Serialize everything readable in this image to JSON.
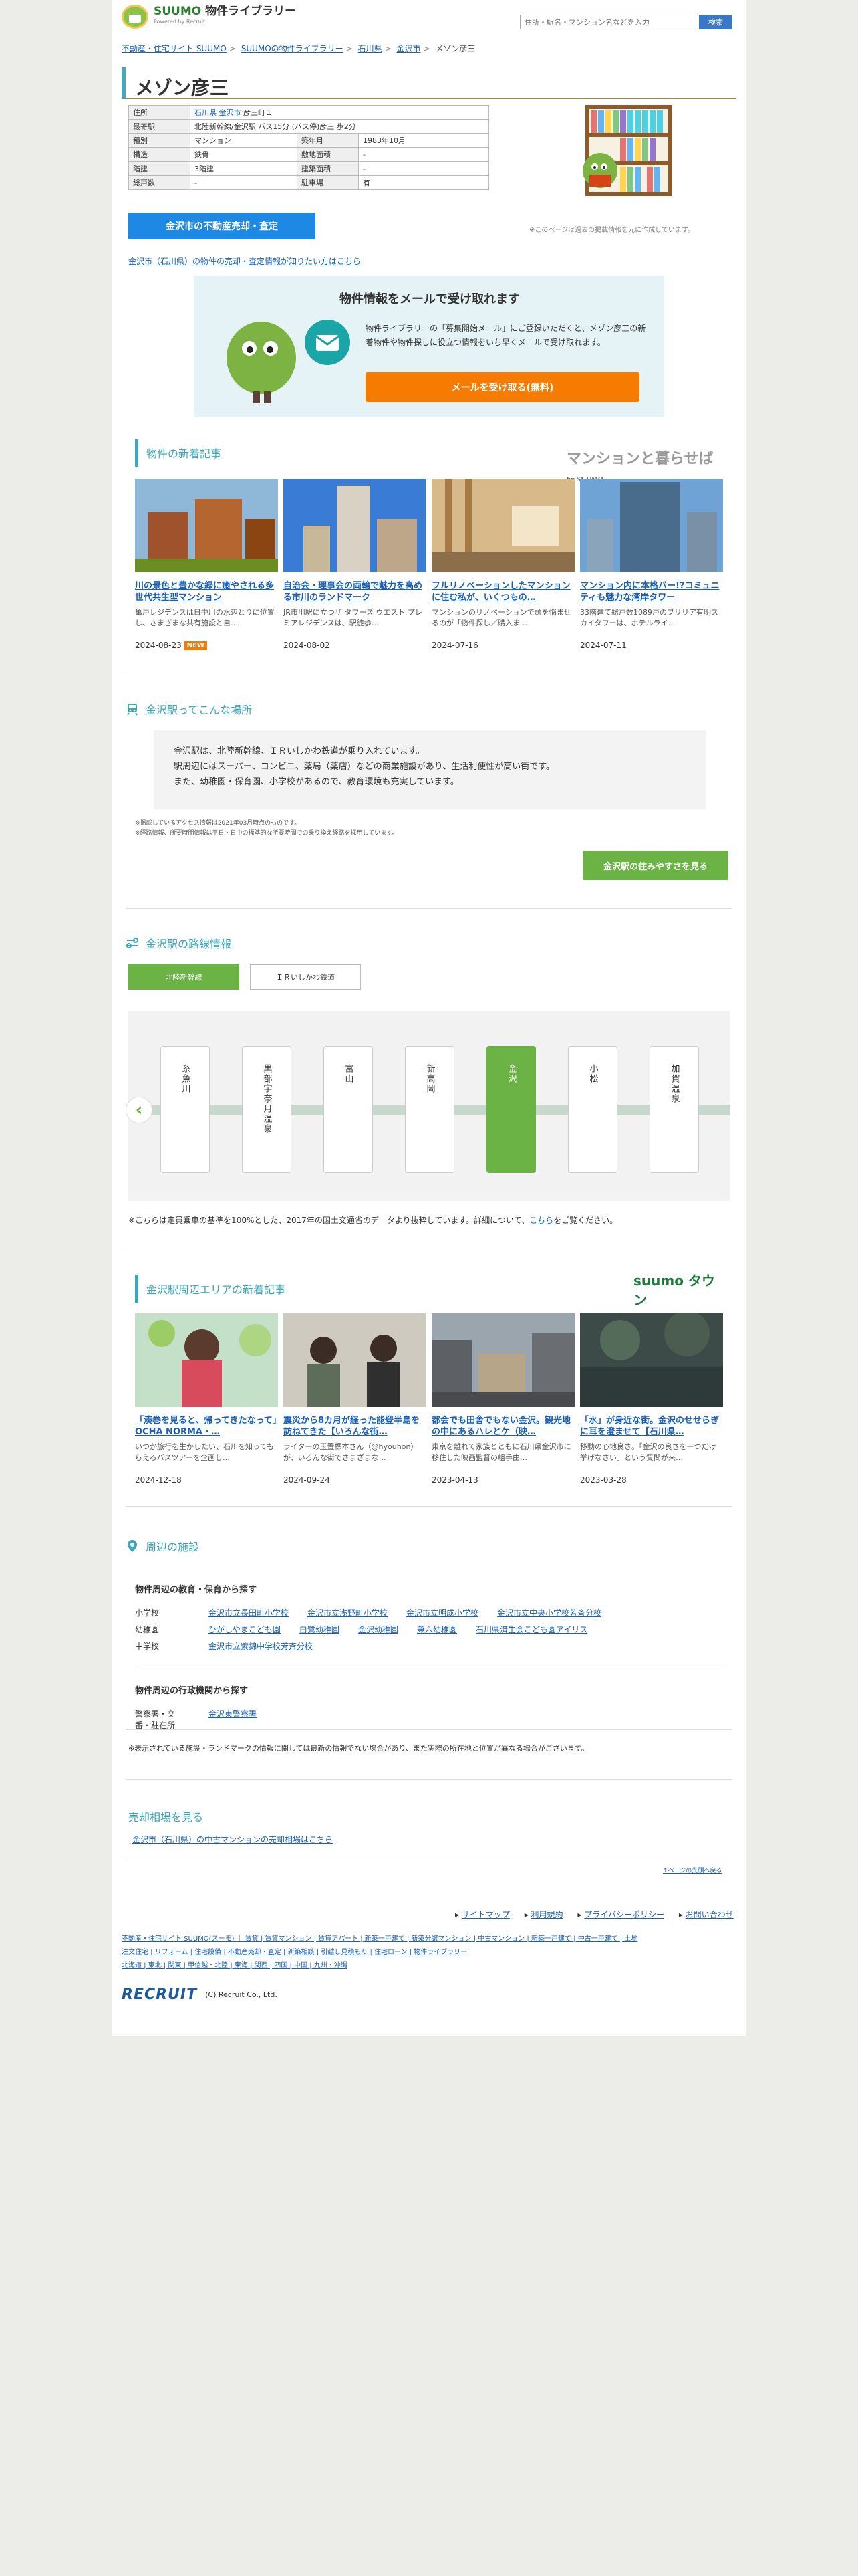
{
  "header": {
    "brand": "SUUMO",
    "brand_sub": "物件ライブラリー",
    "powered": "Powered by Recruit",
    "search_placeholder": "住所・駅名・マンション名などを入力",
    "search_button": "検索"
  },
  "breadcrumb": [
    "不動産・住宅サイト SUUMO",
    "SUUMOの物件ライブラリー",
    "石川県",
    "金沢市",
    "メゾン彦三"
  ],
  "title": "メゾン彦三",
  "info": {
    "rows": [
      {
        "k": "住所",
        "v": "石川県 金沢市 彦三町１",
        "full": true,
        "links": [
          "石川県",
          "金沢市"
        ]
      },
      {
        "k": "最寄駅",
        "v": "北陸新幹線/金沢駅 バス15分 (バス停)彦三 歩2分",
        "full": true
      },
      {
        "k": "種別",
        "v": "マンション",
        "k2": "築年月",
        "v2": "1983年10月"
      },
      {
        "k": "構造",
        "v": "鉄骨",
        "k2": "敷地面積",
        "v2": "-"
      },
      {
        "k": "階建",
        "v": "3階建",
        "k2": "建築面積",
        "v2": "-"
      },
      {
        "k": "総戸数",
        "v": "-",
        "k2": "駐車場",
        "v2": "有"
      }
    ],
    "image_note": "※このページは過去の掲載情報を元に作成しています。",
    "sale_button": "金沢市の不動産売却・査定",
    "sale_link": "金沢市（石川県）の物件の売却・査定情報が知りたい方はこちら"
  },
  "mail": {
    "heading": "物件情報をメールで受け取れます",
    "text": "物件ライブラリーの「募集開始メール」にご登録いただくと、メゾン彦三の新着物件や物件探しに役立つ情報をいち早くメールで受け取れます。",
    "button": "メールを受け取る(無料)"
  },
  "new_articles": {
    "title": "物件の新着記事",
    "brand": "マンションと暮らせば",
    "brand_sub": "by SUUMO",
    "items": [
      {
        "title": "川の景色と豊かな緑に癒やされる多世代共生型マンション",
        "desc": "亀戸レジデンスは日中川の水辺とりに位置し、さまざまな共有施設と自…",
        "date": "2024-08-23",
        "badge": "NEW"
      },
      {
        "title": "自治会・理事会の両輪で魅力を高める市川のランドマーク",
        "desc": "JR市川駅に立つザ タワーズ ウエスト プレミアレジデンスは、駅徒歩…",
        "date": "2024-08-02",
        "badge": ""
      },
      {
        "title": "フルリノベーションしたマンションに住む私が、いくつもの…",
        "desc": "マンションのリノベーションで頭を悩ませるのが「物件探し／購入ま…",
        "date": "2024-07-16",
        "badge": ""
      },
      {
        "title": "マンション内に本格バー!?コミュニティも魅力な湾岸タワー",
        "desc": "33階建て総戸数1089戸のブリリア有明スカイタワーは、ホテルライ…",
        "date": "2024-07-11",
        "badge": ""
      }
    ]
  },
  "station": {
    "title": "金沢駅ってこんな場所",
    "desc": [
      "金沢駅は、北陸新幹線、ＩＲいしかわ鉄道が乗り入れています。",
      "駅周辺にはスーパー、コンビニ、薬局（薬店）などの商業施設があり、生活利便性が高い街です。",
      "また、幼稚園・保育園、小学校があるので、教育環境も充実しています。"
    ],
    "notes": [
      "※掲載しているアクセス情報は2021年03月時点のものです。",
      "※経路情報、所要時間情報は平日・日中の標準的な所要時間での乗り換え経路を採用しています。"
    ],
    "button": "金沢駅の住みやすさを見る"
  },
  "route": {
    "title": "金沢駅の路線情報",
    "tabs": [
      "北陸新幹線",
      "ＩＲいしかわ鉄道"
    ],
    "stations": [
      "糸魚川",
      "黒部宇奈月温泉",
      "富山",
      "新高岡",
      "金沢",
      "小松",
      "加賀温泉"
    ],
    "current": "金沢",
    "note": "※こちらは定員乗車の基準を100%とした、2017年の国土交通省のデータより抜粋しています。詳細について、",
    "note_link": "こちら",
    "note_end": "をご覧ください。"
  },
  "area_articles": {
    "title": "金沢駅周辺エリアの新着記事",
    "brand": "suumo タウン",
    "items": [
      {
        "title": "「湊巻を見ると、帰ってきたなって」　OCHA NORMA・…",
        "desc": "いつか旅行を生かしたい、石川を知ってもらえるバスツアーを企画し…",
        "date": "2024-12-18"
      },
      {
        "title": "震災から8カ月が経った能登半島を訪ねてきた【いろんな街…",
        "desc": "ライターの玉置標本さん（@hyouhon）が、いろんな街でさまざまな…",
        "date": "2024-09-24"
      },
      {
        "title": "都会でも田舎でもない金沢。観光地の中にあるハレとケ（映…",
        "desc": "東京を離れて家族とともに石川県金沢市に移住した映画監督の岨手由…",
        "date": "2023-04-13"
      },
      {
        "title": "「水」が身近な街。金沢のせせらぎに耳を澄ませて【石川県…",
        "desc": "移動の心地良さ。「金沢の良さをーつだけ挙げなさい」という質問が来…",
        "date": "2023-03-28"
      }
    ]
  },
  "facilities": {
    "title": "周辺の施設",
    "sub1": "物件周辺の教育・保育から探す",
    "rows": [
      {
        "k": "小学校",
        "v": [
          "金沢市立長田町小学校",
          "金沢市立浅野町小学校",
          "金沢市立明成小学校",
          "金沢市立中央小学校芳斉分校"
        ]
      },
      {
        "k": "幼稚園",
        "v": [
          "ひがしやまこども園",
          "白鷺幼稚園",
          "金沢幼稚園",
          "兼六幼稚園",
          "石川県済生会こども園アイリス"
        ]
      },
      {
        "k": "中学校",
        "v": [
          "金沢市立紫錦中学校芳斉分校"
        ]
      }
    ],
    "sub2": "物件周辺の行政機関から探す",
    "rows2": [
      {
        "k": "警察署・交番・駐在所",
        "v": [
          "金沢東警察署"
        ]
      }
    ],
    "note": "※表示されている施設・ランドマークの情報に関しては最新の情報でない場合があり、また実際の所在地と位置が異なる場合がございます。"
  },
  "market": {
    "title": "売却相場を見る",
    "link": "金沢市（石川県）の中古マンションの売却相場はこちら"
  },
  "pagetop": "↑ページの先頭へ戻る",
  "footer": {
    "links": [
      "サイトマップ",
      "利用規約",
      "プライバシーポリシー",
      "お問い合わせ"
    ],
    "small1": "不動産・住宅サイト SUUMO(スーモ) ｜ 賃貸 | 賃貸マンション | 賃貸アパート | 新築一戸建て | 新築分譲マンション | 中古マンション | 新築一戸建て | 中古一戸建て | 土地",
    "small2": "注文住宅 | リフォーム | 住宅設備 | 不動産売却・査定 | 新築相談 | 引越し見積もり | 住宅ローン | 物件ライブラリー",
    "small3": "北海道 | 東北 | 関東 | 甲信越・北陸 | 東海 | 関西 | 四国 | 中国 | 九州・沖縄",
    "logo": "RECRUIT",
    "copyright": "(C) Recruit Co., Ltd."
  }
}
